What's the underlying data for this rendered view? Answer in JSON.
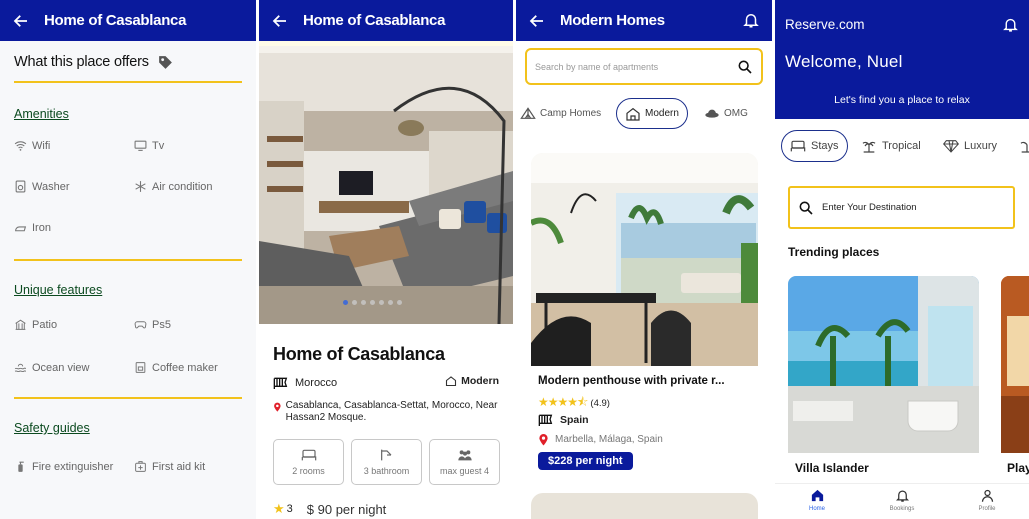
{
  "colors": {
    "primary": "#0a1a9c",
    "accent": "#f2c21b",
    "section": "#0b4a1f"
  },
  "screen1": {
    "header_title": "Home of Casablanca",
    "offers_title": "What this place offers",
    "sections": {
      "amenities": "Amenities",
      "unique": "Unique features",
      "safety": "Safety guides"
    },
    "amenities": [
      {
        "label": "Wifi",
        "icon": "wifi-icon"
      },
      {
        "label": "Tv",
        "icon": "tv-icon"
      },
      {
        "label": "Washer",
        "icon": "washer-icon"
      },
      {
        "label": "Air condition",
        "icon": "snowflake-icon"
      },
      {
        "label": "Iron",
        "icon": "iron-icon"
      }
    ],
    "unique": [
      {
        "label": "Patio",
        "icon": "patio-icon"
      },
      {
        "label": "Ps5",
        "icon": "gamepad-icon"
      },
      {
        "label": "Ocean view",
        "icon": "ocean-icon"
      },
      {
        "label": "Coffee maker",
        "icon": "coffee-icon"
      }
    ],
    "safety": [
      {
        "label": "Fire extinguisher",
        "icon": "extinguisher-icon"
      },
      {
        "label": "First aid kit",
        "icon": "first-aid-icon"
      }
    ]
  },
  "screen2": {
    "header_title": "Home of Casablanca",
    "title": "Home of Casablanca",
    "country": "Morocco",
    "type": "Modern",
    "address": "Casablanca, Casablanca-Settat, Morocco, Near Hassan2 Mosque.",
    "stats": [
      "2 rooms",
      "3 bathroom",
      "max guest 4"
    ],
    "rating": "3",
    "price": "$ 90 per night",
    "carousel": {
      "count": 7,
      "active": 0
    }
  },
  "screen3": {
    "header_title": "Modern Homes",
    "search_placeholder": "Search by name of apartments",
    "categories": [
      "Camp Homes",
      "Modern",
      "OMG"
    ],
    "listing": {
      "title": "Modern penthouse with private r...",
      "rating_text": "(4.9)",
      "stars": 4.5,
      "country": "Spain",
      "location": "Marbella, Málaga, Spain",
      "price": "$228 per night"
    }
  },
  "screen4": {
    "brand": "Reserve.com",
    "welcome": "Welcome, Nuel",
    "subtitle": "Let's find you a place to relax",
    "categories": [
      "Stays",
      "Tropical",
      "Luxury"
    ],
    "search_placeholder": "Enter Your Destination",
    "trending_title": "Trending places",
    "places": [
      "Villa Islander",
      "Play"
    ],
    "tabs": [
      "Home",
      "Bookings",
      "Profile"
    ]
  }
}
